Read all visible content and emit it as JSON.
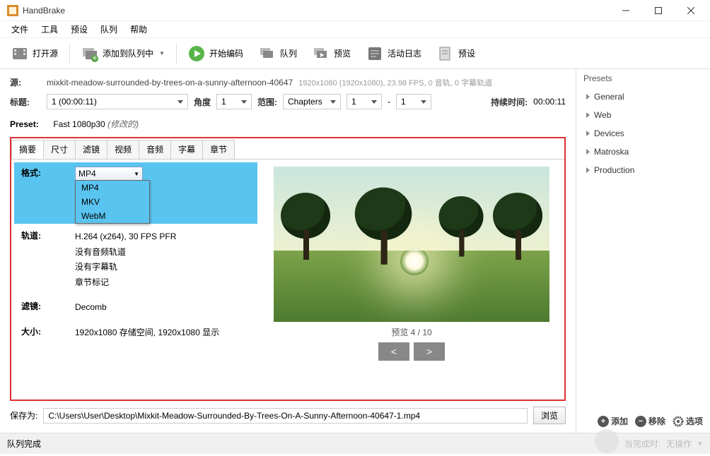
{
  "window": {
    "title": "HandBrake"
  },
  "menu": {
    "file": "文件",
    "tools": "工具",
    "presets": "预设",
    "queue": "队列",
    "help": "帮助"
  },
  "toolbar": {
    "open_source": "打开源",
    "add_queue": "添加到队列中",
    "start": "开始编码",
    "queue": "队列",
    "preview": "预览",
    "activity": "活动日志",
    "presets": "预设"
  },
  "source": {
    "label": "源:",
    "name": "mixkit-meadow-surrounded-by-trees-on-a-sunny-afternoon-40647",
    "info": "1920x1080 (1920x1080), 23.98 FPS, 0 音轨, 0 字幕轨道"
  },
  "title_row": {
    "title_label": "标题:",
    "title_value": "1 (00:00:11)",
    "angle_label": "角度",
    "angle_value": "1",
    "range_label": "范围:",
    "range_type": "Chapters",
    "range_from": "1",
    "range_sep": "-",
    "range_to": "1",
    "duration_label": "持续时间:",
    "duration_value": "00:00:11"
  },
  "preset_row": {
    "label": "Preset:",
    "name": "Fast 1080p30",
    "modified": "(修改的)"
  },
  "tabs": {
    "summary": "摘要",
    "dimensions": "尺寸",
    "filters": "滤镜",
    "video": "视频",
    "audio": "音频",
    "subtitles": "字幕",
    "chapters": "章节"
  },
  "summary": {
    "format_label": "格式:",
    "format_value": "MP4",
    "format_options": [
      "MP4",
      "MKV",
      "WebM"
    ],
    "tracks_label": "轨道:",
    "tracks_video": "H.264 (x264), 30 FPS PFR",
    "tracks_audio_none": "没有音频轨道",
    "tracks_sub_none": "没有字幕轨",
    "tracks_chapter": "章节标记",
    "filters_label": "滤镜:",
    "filters_value": "Decomb",
    "size_label": "大小:",
    "size_value": "1920x1080 存储空间, 1920x1080 显示"
  },
  "preview": {
    "label": "预览 4 / 10",
    "prev": "<",
    "next": ">"
  },
  "save": {
    "label": "保存为:",
    "path": "C:\\Users\\User\\Desktop\\Mixkit-Meadow-Surrounded-By-Trees-On-A-Sunny-Afternoon-40647-1.mp4",
    "browse": "浏览"
  },
  "sidebar": {
    "header": "Presets",
    "items": [
      "General",
      "Web",
      "Devices",
      "Matroska",
      "Production"
    ],
    "add": "添加",
    "remove": "移除",
    "options": "选项"
  },
  "status": {
    "left": "队列完成",
    "right_label": "当完成时:",
    "right_value": "无操作"
  }
}
